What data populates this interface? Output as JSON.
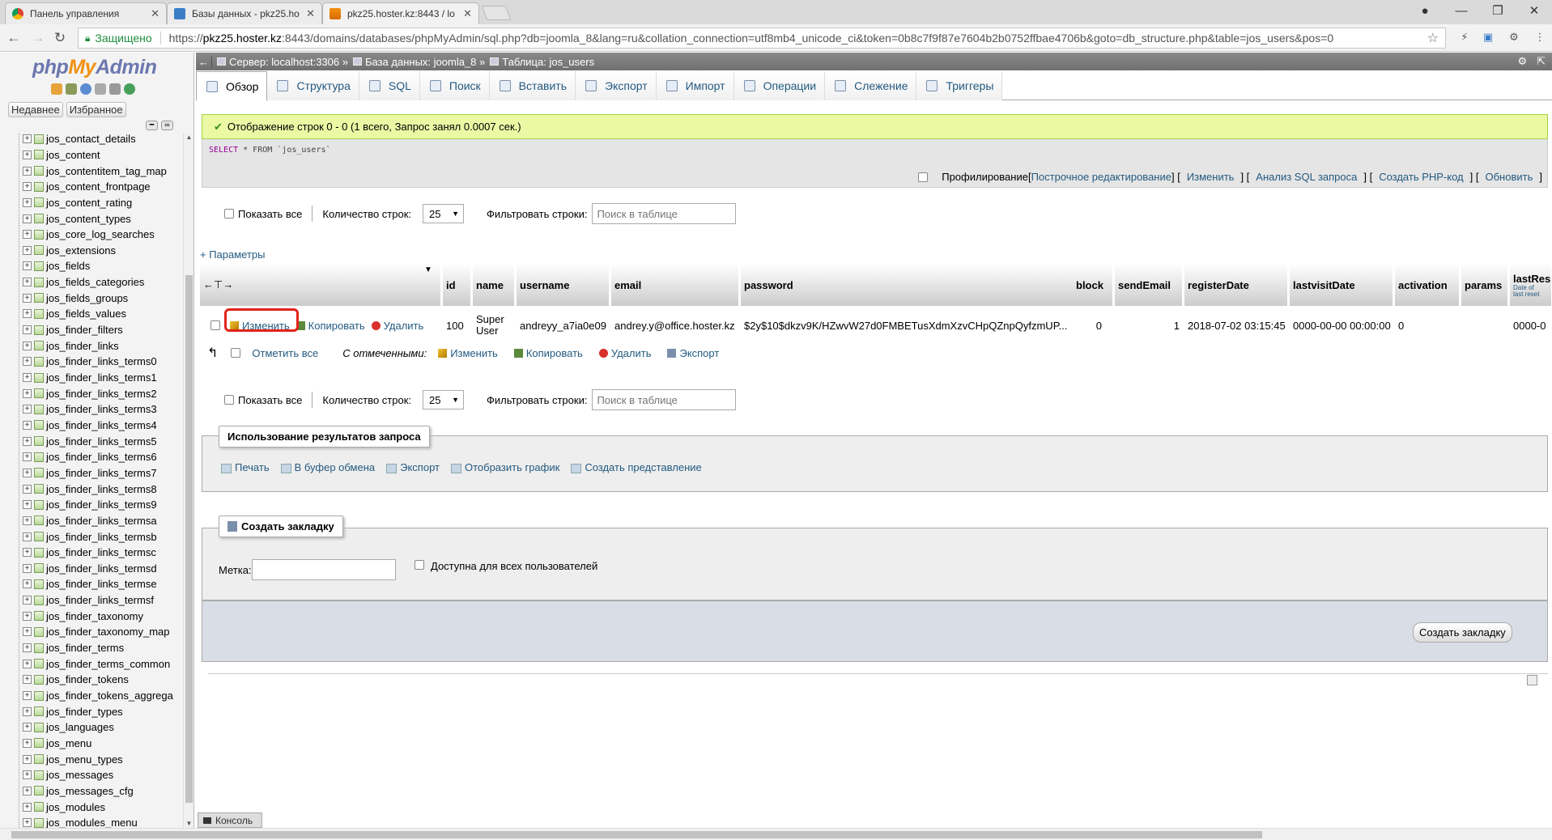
{
  "browser": {
    "tabs": [
      {
        "title": "Панель управления",
        "icon": "chrome-favicon"
      },
      {
        "title": "Базы данных - pkz25.ho",
        "icon": "plesk-favicon"
      },
      {
        "title": "pkz25.hoster.kz:8443 / lo",
        "icon": "pma-favicon"
      }
    ],
    "secure_label": "Защищено",
    "url_prefix": "https://",
    "url_host": "pkz25.hoster.kz",
    "url_rest": ":8443/domains/databases/phpMyAdmin/sql.php?db=joomla_8&lang=ru&collation_connection=utf8mb4_unicode_ci&token=0b8c7f9f87e7604b2b0752ffbae4706b&goto=db_structure.php&table=jos_users&pos=0"
  },
  "sidebar": {
    "logo": {
      "php": "php",
      "my": "My",
      "admin": "Admin"
    },
    "recent_label": "Недавнее",
    "favorites_label": "Избранное",
    "tables": [
      "jos_contact_details",
      "jos_content",
      "jos_contentitem_tag_map",
      "jos_content_frontpage",
      "jos_content_rating",
      "jos_content_types",
      "jos_core_log_searches",
      "jos_extensions",
      "jos_fields",
      "jos_fields_categories",
      "jos_fields_groups",
      "jos_fields_values",
      "jos_finder_filters",
      "jos_finder_links",
      "jos_finder_links_terms0",
      "jos_finder_links_terms1",
      "jos_finder_links_terms2",
      "jos_finder_links_terms3",
      "jos_finder_links_terms4",
      "jos_finder_links_terms5",
      "jos_finder_links_terms6",
      "jos_finder_links_terms7",
      "jos_finder_links_terms8",
      "jos_finder_links_terms9",
      "jos_finder_links_termsa",
      "jos_finder_links_termsb",
      "jos_finder_links_termsc",
      "jos_finder_links_termsd",
      "jos_finder_links_termse",
      "jos_finder_links_termsf",
      "jos_finder_taxonomy",
      "jos_finder_taxonomy_map",
      "jos_finder_terms",
      "jos_finder_terms_common",
      "jos_finder_tokens",
      "jos_finder_tokens_aggrega",
      "jos_finder_types",
      "jos_languages",
      "jos_menu",
      "jos_menu_types",
      "jos_messages",
      "jos_messages_cfg",
      "jos_modules",
      "jos_modules_menu"
    ]
  },
  "breadcrumb": {
    "server": "Сервер: localhost:3306 »",
    "database": "База данных: joomla_8 »",
    "table": "Таблица: jos_users"
  },
  "menu": [
    {
      "label": "Обзор",
      "icon": "browse-icon"
    },
    {
      "label": "Структура",
      "icon": "structure-icon"
    },
    {
      "label": "SQL",
      "icon": "sql-icon"
    },
    {
      "label": "Поиск",
      "icon": "search-icon"
    },
    {
      "label": "Вставить",
      "icon": "insert-icon"
    },
    {
      "label": "Экспорт",
      "icon": "export-icon"
    },
    {
      "label": "Импорт",
      "icon": "import-icon"
    },
    {
      "label": "Операции",
      "icon": "operations-icon"
    },
    {
      "label": "Слежение",
      "icon": "tracking-icon"
    },
    {
      "label": "Триггеры",
      "icon": "triggers-icon"
    }
  ],
  "message": "Отображение строк 0 - 0 (1 всего, Запрос занял 0.0007 сек.)",
  "sql": {
    "select": "SELECT",
    "rest": " * FROM `jos_users`"
  },
  "sql_options": {
    "profiling": "Профилирование",
    "inline_edit": "Построчное редактирование",
    "edit": "Изменить",
    "explain": "Анализ SQL запроса",
    "php_code": "Создать PHP-код",
    "refresh": "Обновить"
  },
  "nav": {
    "show_all": "Показать все",
    "rows_label": "Количество строк:",
    "rows_value": "25",
    "filter_label": "Фильтровать строки:",
    "filter_placeholder": "Поиск в таблице"
  },
  "params_link": "+ Параметры",
  "table": {
    "columns": [
      "id",
      "name",
      "username",
      "email",
      "password",
      "block",
      "sendEmail",
      "registerDate",
      "lastvisitDate",
      "activation",
      "params",
      "lastRes"
    ],
    "lastres_sub": "Date of last reset",
    "row": {
      "actions": {
        "edit": "Изменить",
        "copy": "Копировать",
        "delete": "Удалить"
      },
      "id": "100",
      "name_1": "Super",
      "name_2": "User",
      "username": "andreyy_a7ia0e09",
      "email": "andrey.y@office.hoster.kz",
      "password": "$2y$10$dkzv9K/HZwvW27d0FMBETusXdmXzvCHpQZnpQyfzmUP...",
      "block": "0",
      "sendEmail": "1",
      "registerDate": "2018-07-02 03:15:45",
      "lastvisitDate": "0000-00-00 00:00:00",
      "activation": "0",
      "params": "",
      "lastRes": "0000-0"
    }
  },
  "with_selected": {
    "check_all": "Отметить все",
    "label": "С отмеченными:",
    "edit": "Изменить",
    "copy": "Копировать",
    "delete": "Удалить",
    "export": "Экспорт"
  },
  "query_results": {
    "legend": "Использование результатов запроса",
    "print": "Печать",
    "clipboard": "В буфер обмена",
    "export": "Экспорт",
    "chart": "Отобразить график",
    "view": "Создать представление"
  },
  "bookmark": {
    "legend": "Создать закладку",
    "label": "Метка:",
    "public": "Доступна для всех пользователей",
    "button": "Создать закладку"
  },
  "console": "Консоль"
}
